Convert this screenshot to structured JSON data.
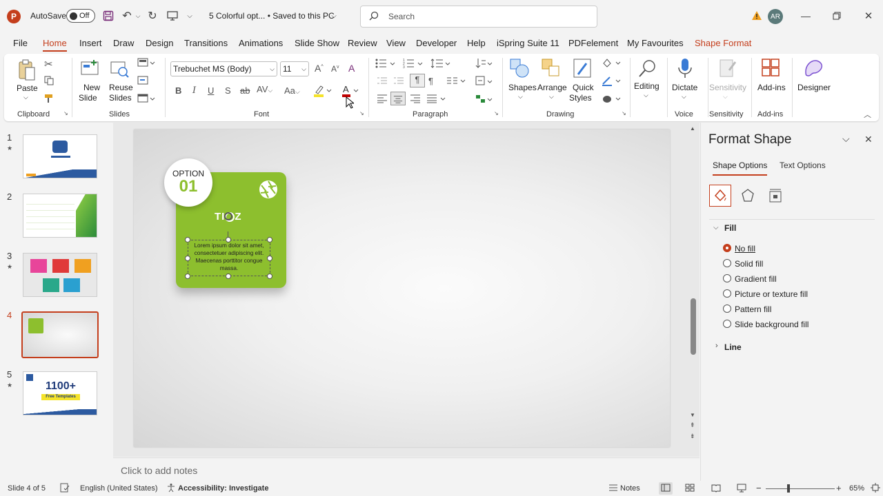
{
  "titlebar": {
    "autosave_label": "AutoSave",
    "autosave_state": "Off",
    "doc_title": "5 Colorful opt... • Saved to this PC",
    "search_placeholder": "Search",
    "avatar_initials": "AR"
  },
  "menu": {
    "tabs": [
      "File",
      "Home",
      "Insert",
      "Draw",
      "Design",
      "Transitions",
      "Animations",
      "Slide Show",
      "Review",
      "View",
      "Developer",
      "Help",
      "iSpring Suite 11",
      "PDFelement",
      "My Favourites",
      "Shape Format"
    ],
    "active": "Home"
  },
  "ribbon": {
    "clipboard": {
      "paste": "Paste",
      "group": "Clipboard"
    },
    "slides": {
      "new_slide": "New",
      "new_slide2": "Slide",
      "reuse": "Reuse",
      "reuse2": "Slides",
      "group": "Slides"
    },
    "font": {
      "family": "Trebuchet MS (Body)",
      "size": "11",
      "group": "Font"
    },
    "paragraph": {
      "group": "Paragraph"
    },
    "drawing": {
      "shapes": "Shapes",
      "arrange": "Arrange",
      "quick_styles": "Quick",
      "quick_styles2": "Styles",
      "group": "Drawing"
    },
    "editing": {
      "label": "Editing"
    },
    "voice": {
      "dictate": "Dictate",
      "group": "Voice"
    },
    "sensitivity": {
      "label": "Sensitivity",
      "group": "Sensitivity"
    },
    "addins": {
      "label": "Add-ins",
      "group": "Add-ins"
    },
    "designer": {
      "label": "Designer"
    }
  },
  "thumbnails": [
    {
      "num": "1",
      "starred": true
    },
    {
      "num": "2",
      "starred": false
    },
    {
      "num": "3",
      "starred": true
    },
    {
      "num": "4",
      "starred": false,
      "selected": true
    },
    {
      "num": "5",
      "starred": true,
      "headline": "1100+",
      "sub": "Free Templates"
    }
  ],
  "slide": {
    "option_label": "OPTION",
    "option_number": "01",
    "body_text": "Lorem ipsum dolor sit amet, consectetuer adipiscing elit. Maecenas porttitor congue massa.",
    "accent_color": "#8dbf2e"
  },
  "notes": {
    "placeholder": "Click to add notes"
  },
  "format_pane": {
    "title": "Format Shape",
    "tab_shape": "Shape Options",
    "tab_text": "Text Options",
    "fill_heading": "Fill",
    "fill_options": [
      "No fill",
      "Solid fill",
      "Gradient fill",
      "Picture or texture fill",
      "Pattern fill",
      "Slide background fill"
    ],
    "selected_fill": "No fill",
    "line_heading": "Line"
  },
  "status": {
    "slide_info": "Slide 4 of 5",
    "language": "English (United States)",
    "accessibility": "Accessibility: Investigate",
    "notes": "Notes",
    "zoom": "65%"
  }
}
